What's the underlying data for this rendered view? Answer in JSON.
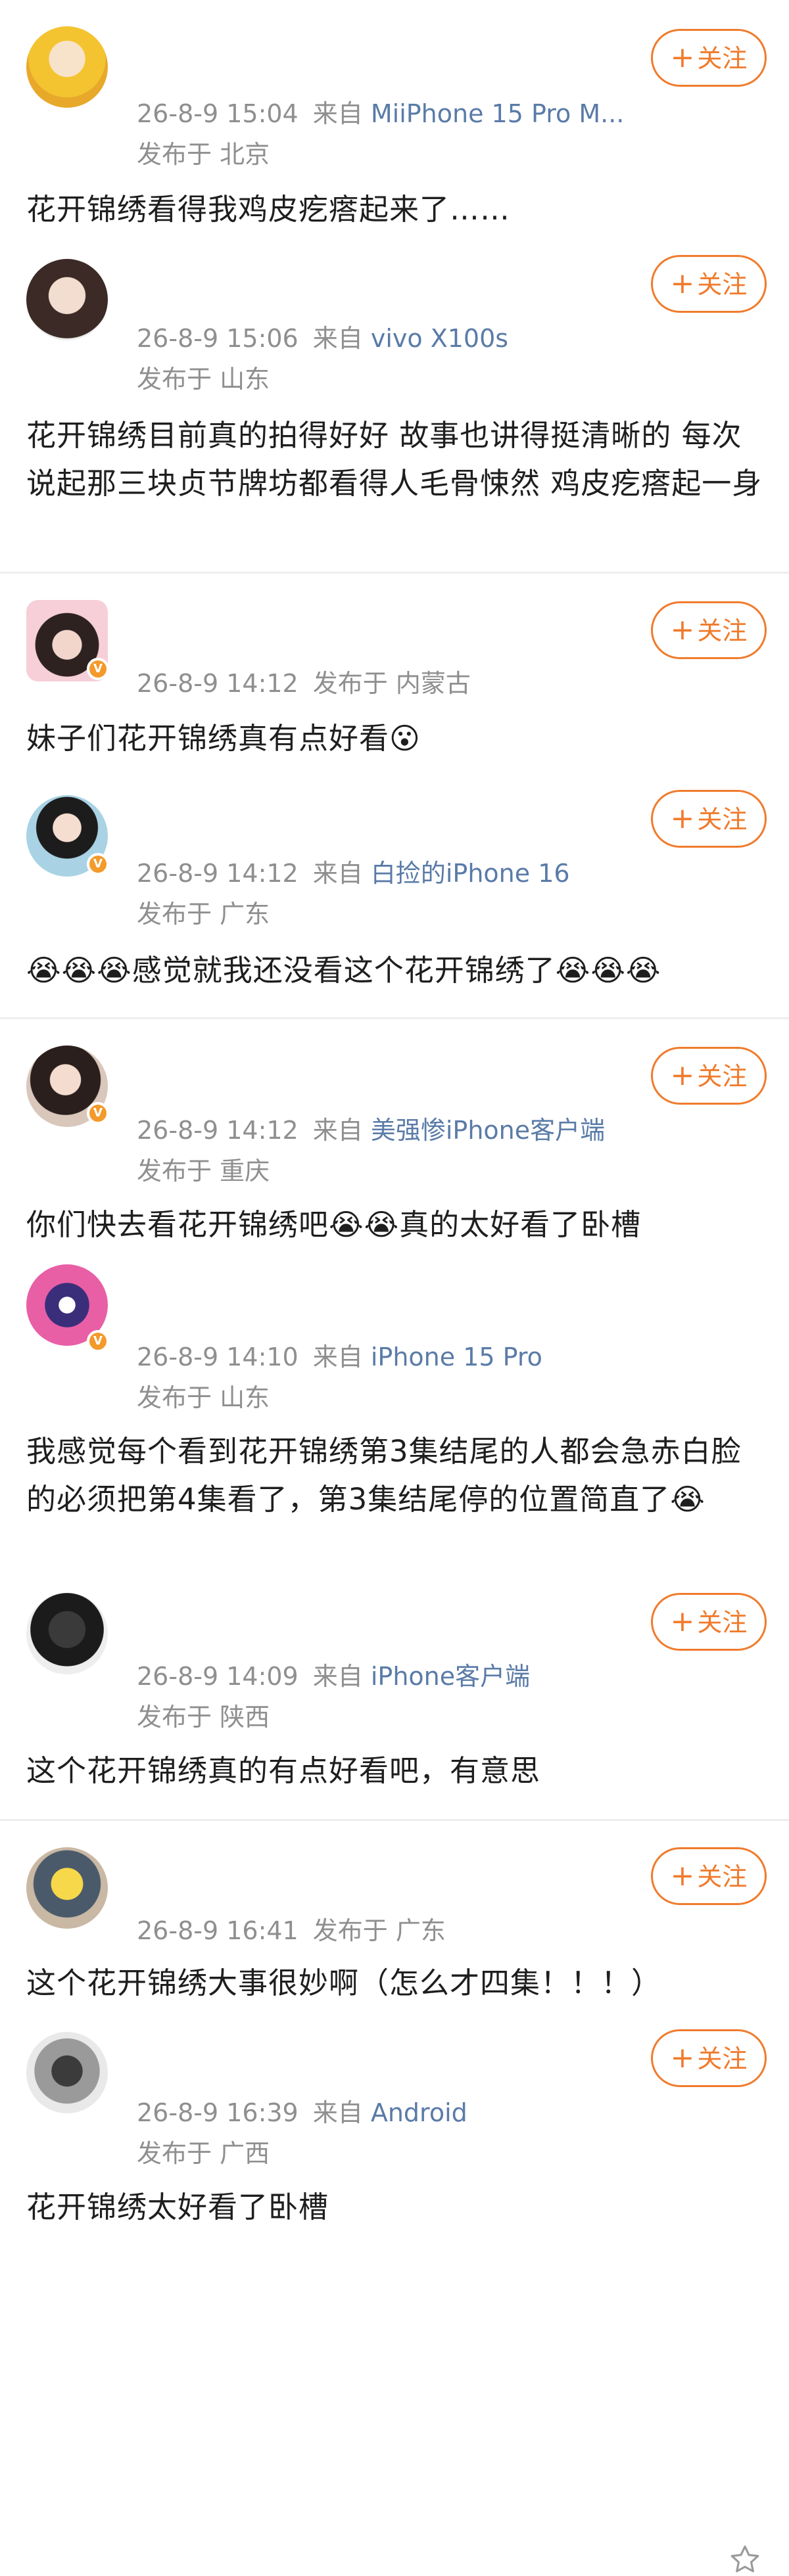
{
  "posts": [
    {
      "timestamp": "26-8-9 15:04",
      "source_label": "来自",
      "source": "MiiPhone 15 Pro M...",
      "location": "发布于 北京",
      "content": "花开锦绣看得我鸡皮疙瘩起来了……",
      "follow": "关注"
    },
    {
      "timestamp": "26-8-9 15:06",
      "source_label": "来自",
      "source": "vivo X100s",
      "location": "发布于 山东",
      "content": "花开锦绣目前真的拍得好好 故事也讲得挺清晰的 每次说起那三块贞节牌坊都看得人毛骨悚然 鸡皮疙瘩起一身",
      "follow": "关注"
    },
    {
      "timestamp": "26-8-9 14:12",
      "location": "发布于 内蒙古",
      "content": "妹子们花开锦绣真有点好看😮",
      "follow": "关注"
    },
    {
      "timestamp": "26-8-9 14:12",
      "source_label": "来自",
      "source": "白捡的iPhone 16",
      "location": "发布于 广东",
      "content": "😭😭😭感觉就我还没看这个花开锦绣了😭😭😭",
      "follow": "关注"
    },
    {
      "timestamp": "26-8-9 14:12",
      "source_label": "来自",
      "source": "美强惨iPhone客户端",
      "location": "发布于 重庆",
      "content": "你们快去看花开锦绣吧😭😭真的太好看了卧槽",
      "follow": "关注"
    },
    {
      "timestamp": "26-8-9 14:10",
      "source_label": "来自",
      "source": "iPhone 15 Pro",
      "location": "发布于 山东",
      "content": "我感觉每个看到花开锦绣第3集结尾的人都会急赤白脸的必须把第4集看了，第3集结尾停的位置简直了😭"
    },
    {
      "timestamp": "26-8-9 14:09",
      "source_label": "来自",
      "source": "iPhone客户端",
      "location": "发布于 陕西",
      "content": "这个花开锦绣真的有点好看吧，有意思",
      "follow": "关注"
    },
    {
      "timestamp": "26-8-9 16:41",
      "location": "发布于 广东",
      "content": "这个花开锦绣大事很妙啊（怎么才四集！！！）",
      "follow": "关注"
    },
    {
      "timestamp": "26-8-9 16:39",
      "source_label": "来自",
      "source": "Android",
      "location": "发布于 广西",
      "content": "花开锦绣太好看了卧槽",
      "follow": "关注"
    }
  ],
  "colors": {
    "accent": "#f07b2c",
    "source_link": "#5a7ba8",
    "meta": "#8f8f8f",
    "verified": "#f39a2b"
  }
}
